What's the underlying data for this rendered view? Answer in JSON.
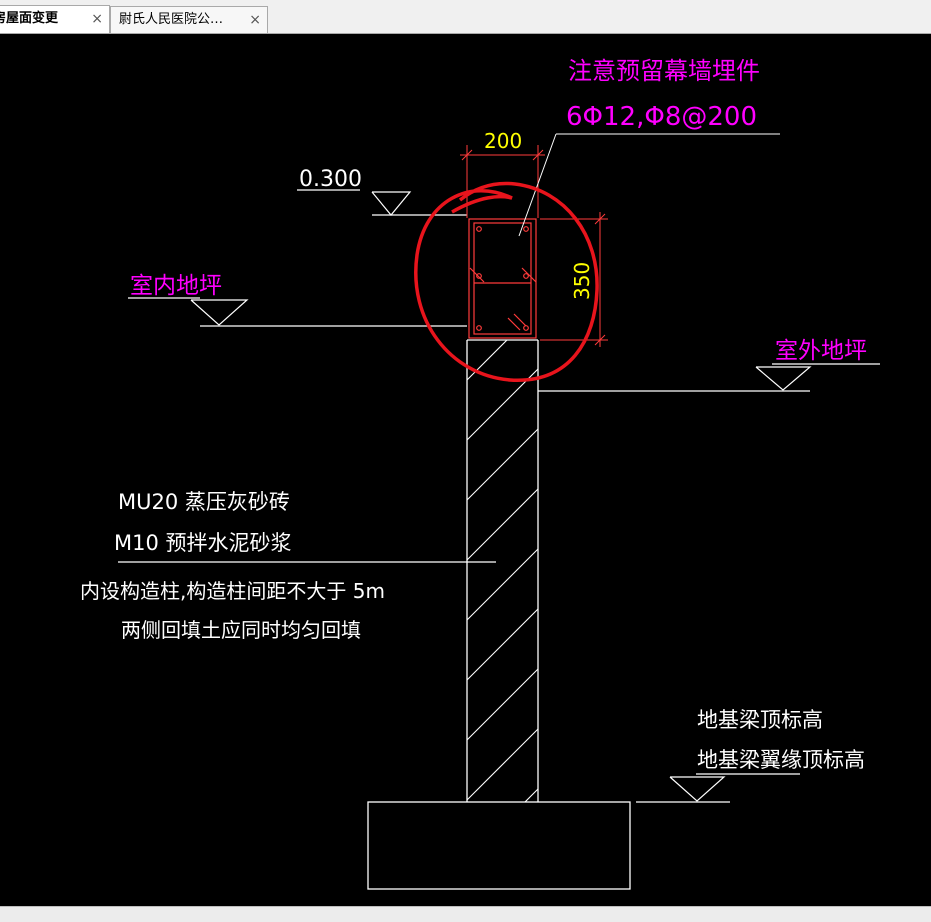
{
  "tabs": [
    {
      "label": "房屋面变更",
      "active": true,
      "close": "×"
    },
    {
      "label": "尉氏人民医院公…",
      "active": false,
      "close": "×"
    }
  ],
  "drawing": {
    "note_line1": "注意预留幕墙埋件",
    "note_line2": "6Φ12,Φ8@200",
    "dim_width": "200",
    "dim_height": "350",
    "level_value": "0.300",
    "indoor_floor": "室内地坪",
    "outdoor_floor": "室外地坪",
    "material_line1": "MU20 蒸压灰砂砖",
    "material_line2": "M10 预拌水泥砂浆",
    "remark_line1": "内设构造柱,构造柱间距不大于  5m",
    "remark_line2": "两侧回填土应同时均匀回填",
    "beam_label1": "地基梁顶标高",
    "beam_label2": "地基梁翼缘顶标高"
  },
  "colors": {
    "background": "#000000",
    "linework": "#ffffff",
    "dimension": "#ffff00",
    "annotation": "#ff00ff",
    "rebar": "#ff3b3b",
    "markup_circle": "#e8141c"
  }
}
